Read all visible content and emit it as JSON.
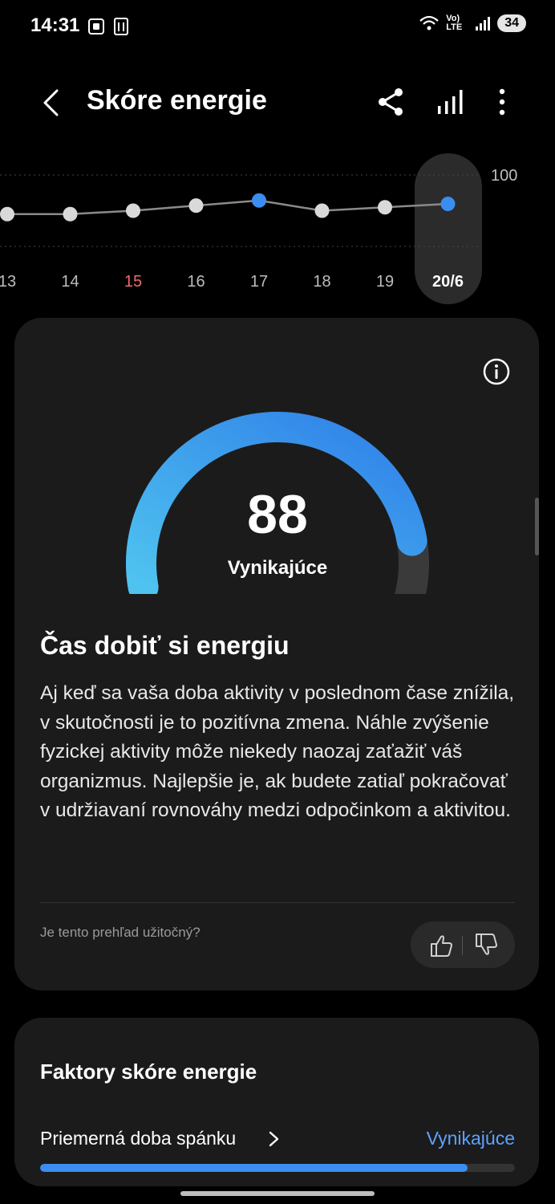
{
  "status_bar": {
    "time": "14:31",
    "net_label": "Vo) LTE",
    "battery": "34"
  },
  "app_bar": {
    "title": "Skóre energie",
    "icons": [
      "back-icon",
      "share-icon",
      "stats-icon",
      "more-icon"
    ]
  },
  "trend": {
    "max_label": "100",
    "days": [
      {
        "label": "13",
        "value": 78,
        "weekend": false,
        "highlight": false
      },
      {
        "label": "14",
        "value": 78,
        "weekend": false,
        "highlight": false
      },
      {
        "label": "15",
        "value": 80,
        "weekend": true,
        "highlight": false
      },
      {
        "label": "16",
        "value": 83,
        "weekend": false,
        "highlight": false
      },
      {
        "label": "17",
        "value": 86,
        "weekend": false,
        "highlight": true
      },
      {
        "label": "18",
        "value": 80,
        "weekend": false,
        "highlight": false
      },
      {
        "label": "19",
        "value": 82,
        "weekend": false,
        "highlight": false
      },
      {
        "label": "20/6",
        "value": 84,
        "weekend": false,
        "highlight": true,
        "selected": true
      }
    ],
    "colors": {
      "point": "#d9d9d9",
      "highlight": "#3b8df0",
      "line": "#8a8a8a"
    }
  },
  "score_card": {
    "score": "88",
    "score_value": 88,
    "rating": "Vynikajúce",
    "insight_title": "Čas dobiť si energiu",
    "insight_body": "Aj keď sa vaša doba aktivity v poslednom čase znížila, v skutočnosti je to pozitívna zmena. Náhle zvýšenie fyzickej aktivity môže niekedy naozaj zaťažiť váš organizmus. Najlepšie je, ak budete zatiaľ pokračovať v udržiavaní rovnováhy medzi odpočinkom a aktivitou.",
    "feedback_question": "Je tento prehľad užitočný?",
    "gauge_colors": {
      "start": "#4fc3f0",
      "end": "#2f7fe8",
      "track": "#3a3a3a"
    }
  },
  "factors": {
    "title": "Faktory skóre energie",
    "items": [
      {
        "name": "Priemerná doba spánku",
        "status": "Vynikajúce",
        "progress": 0.9
      }
    ]
  }
}
